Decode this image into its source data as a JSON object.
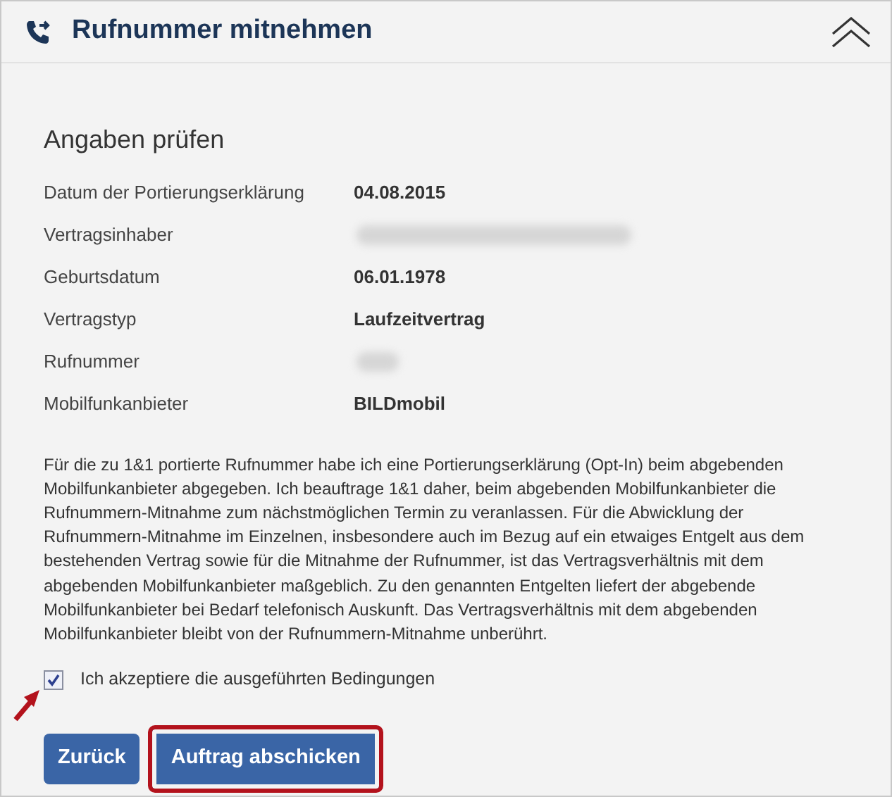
{
  "panel": {
    "title": "Rufnummer mitnehmen",
    "expanded": true
  },
  "section": {
    "heading": "Angaben prüfen"
  },
  "details": [
    {
      "label": "Datum der Portierungserklärung",
      "value": "04.08.2015",
      "redacted": false
    },
    {
      "label": "Vertragsinhaber",
      "redacted": true
    },
    {
      "label": "Geburtsdatum",
      "value": "06.01.1978",
      "redacted": false
    },
    {
      "label": "Vertragstyp",
      "value": "Laufzeitvertrag",
      "redacted": false
    },
    {
      "label": "Rufnummer",
      "redacted": true
    },
    {
      "label": "Mobilfunkanbieter",
      "value": "BILDmobil",
      "redacted": false
    }
  ],
  "declaration": "Für die zu 1&1 portierte Rufnummer habe ich eine Portierungserklärung (Opt-In) beim abgebenden Mobilfunkanbieter abgegeben. Ich beauftrage 1&1 daher, beim abgebenden Mobilfunkanbieter die Rufnummern-Mitnahme zum nächstmöglichen Termin zu veranlassen. Für die Abwicklung der Rufnummern-Mitnahme im Einzelnen, insbesondere auch im Bezug auf ein etwaiges Entgelt aus dem bestehenden Vertrag sowie für die Mitnahme der Rufnummer, ist das Vertragsverhältnis mit dem abgebenden Mobilfunkanbieter maßgeblich. Zu den genannten Entgelten liefert der abgebende Mobilfunkanbieter bei Bedarf telefonisch Auskunft. Das Vertragsverhältnis mit dem abgebenden Mobilfunkanbieter bleibt von der Rufnummern-Mitnahme unberührt.",
  "consent": {
    "label": "Ich akzeptiere die ausgeführten Bedingungen",
    "checked": true,
    "annotated": true
  },
  "buttons": [
    {
      "label": "Zurück",
      "highlighted": false
    },
    {
      "label": "Auftrag abschicken",
      "highlighted": true
    }
  ]
}
